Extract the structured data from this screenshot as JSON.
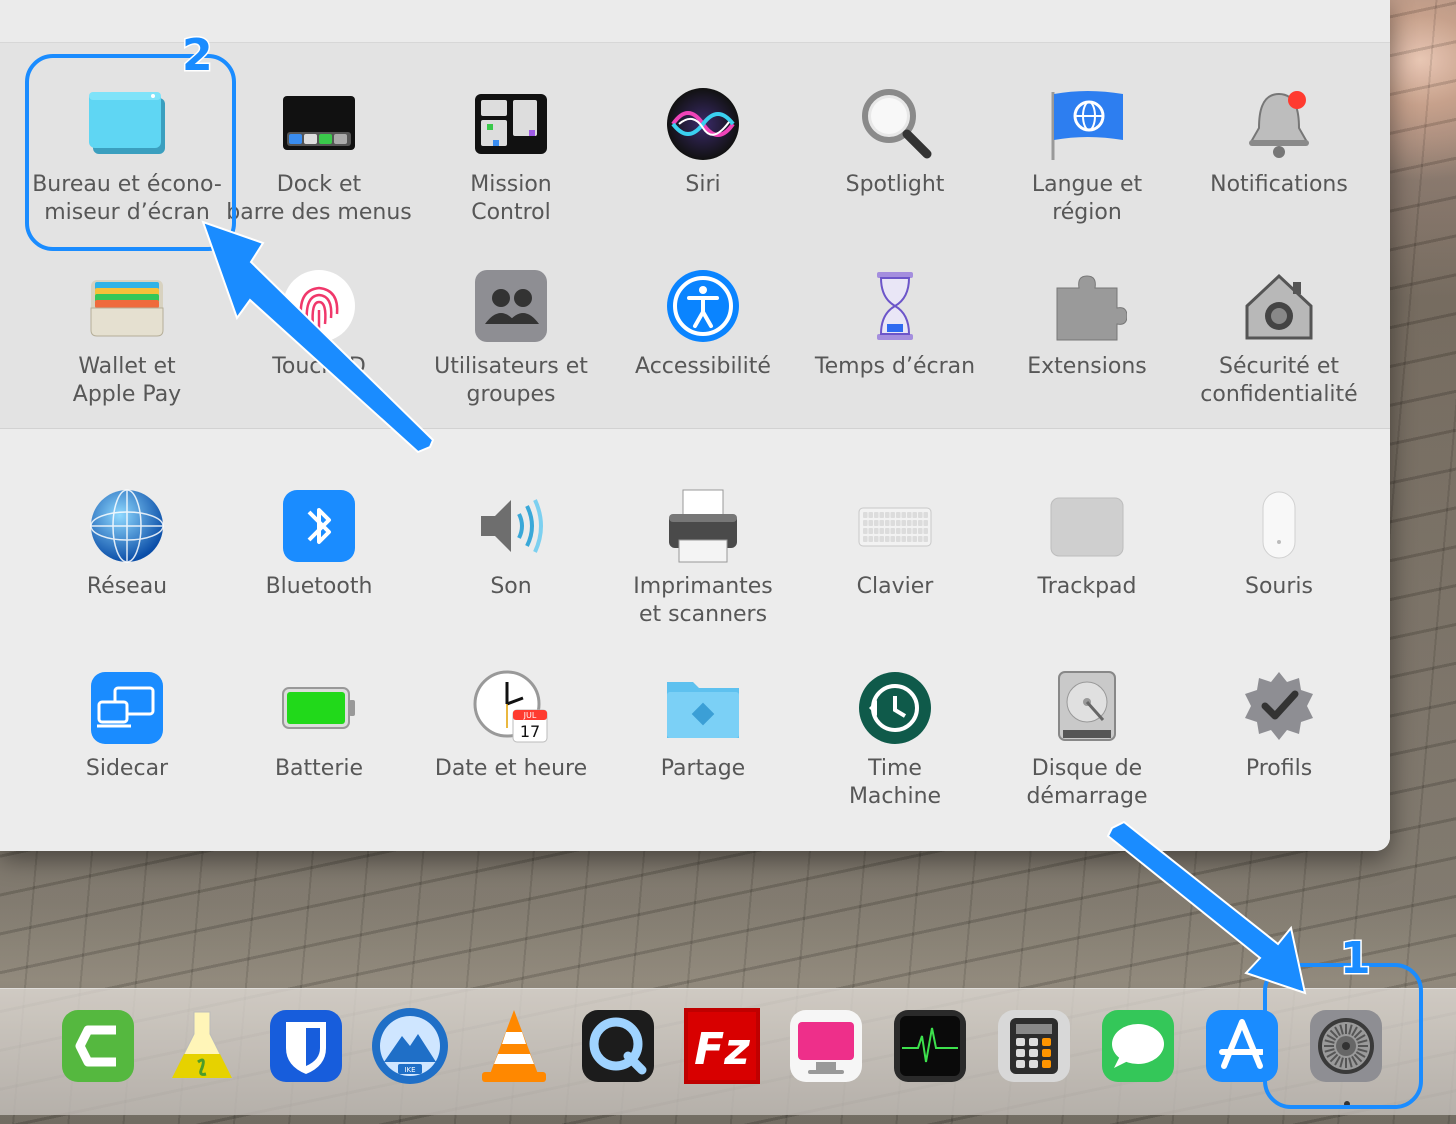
{
  "window": {
    "title": ""
  },
  "sections": [
    {
      "name": "personal",
      "panes": [
        {
          "id": "desktop-screensaver",
          "icon": "desktop-screensaver-icon",
          "lines": [
            "Bureau et écono-",
            "miseur d’écran"
          ]
        },
        {
          "id": "dock-menubar",
          "icon": "dock-icon",
          "lines": [
            "Dock et",
            "barre des menus"
          ]
        },
        {
          "id": "mission-control",
          "icon": "mission-control-icon",
          "lines": [
            "Mission",
            "Control"
          ]
        },
        {
          "id": "siri",
          "icon": "siri-icon",
          "lines": [
            "Siri"
          ]
        },
        {
          "id": "spotlight",
          "icon": "magnifier-icon",
          "lines": [
            "Spotlight"
          ]
        },
        {
          "id": "language-region",
          "icon": "flag-globe-icon",
          "lines": [
            "Langue et",
            "région"
          ]
        },
        {
          "id": "notifications",
          "icon": "bell-icon",
          "lines": [
            "Notifications"
          ]
        },
        {
          "id": "wallet",
          "icon": "wallet-icon",
          "lines": [
            "Wallet et",
            "Apple Pay"
          ]
        },
        {
          "id": "touch-id",
          "icon": "fingerprint-icon",
          "lines": [
            "Touch ID"
          ]
        },
        {
          "id": "users-groups",
          "icon": "users-icon",
          "lines": [
            "Utilisateurs et",
            "groupes"
          ]
        },
        {
          "id": "accessibility",
          "icon": "accessibility-icon",
          "lines": [
            "Accessibilité"
          ]
        },
        {
          "id": "screen-time",
          "icon": "hourglass-icon",
          "lines": [
            "Temps d’écran"
          ]
        },
        {
          "id": "extensions",
          "icon": "puzzle-icon",
          "lines": [
            "Extensions"
          ]
        },
        {
          "id": "security-privacy",
          "icon": "house-lock-icon",
          "lines": [
            "Sécurité et",
            "confidentialité"
          ]
        }
      ]
    },
    {
      "name": "hardware",
      "panes": [
        {
          "id": "network",
          "icon": "globe-network-icon",
          "lines": [
            "Réseau"
          ]
        },
        {
          "id": "bluetooth",
          "icon": "bluetooth-icon",
          "lines": [
            "Bluetooth"
          ]
        },
        {
          "id": "sound",
          "icon": "speaker-icon",
          "lines": [
            "Son"
          ]
        },
        {
          "id": "printers",
          "icon": "printer-icon",
          "lines": [
            "Imprimantes",
            "et scanners"
          ]
        },
        {
          "id": "keyboard",
          "icon": "keyboard-icon",
          "lines": [
            "Clavier"
          ]
        },
        {
          "id": "trackpad",
          "icon": "trackpad-icon",
          "lines": [
            "Trackpad"
          ]
        },
        {
          "id": "mouse",
          "icon": "mouse-icon",
          "lines": [
            "Souris"
          ]
        },
        {
          "id": "sidecar",
          "icon": "sidecar-icon",
          "lines": [
            "Sidecar"
          ]
        },
        {
          "id": "battery",
          "icon": "battery-icon",
          "lines": [
            "Batterie"
          ]
        },
        {
          "id": "date-time",
          "icon": "clock-calendar-icon",
          "lines": [
            "Date et heure"
          ],
          "calendar": {
            "month": "JUL",
            "day": "17"
          }
        },
        {
          "id": "sharing",
          "icon": "shared-folder-icon",
          "lines": [
            "Partage"
          ]
        },
        {
          "id": "time-machine",
          "icon": "time-machine-icon",
          "lines": [
            "Time",
            "Machine"
          ]
        },
        {
          "id": "startup-disk",
          "icon": "hard-disk-icon",
          "lines": [
            "Disque de",
            "démarrage"
          ]
        },
        {
          "id": "profiles",
          "icon": "checkmark-badge-icon",
          "lines": [
            "Profils"
          ]
        }
      ]
    }
  ],
  "dock": {
    "apps": [
      {
        "id": "partial-app",
        "icon": "partial-red-app-icon"
      },
      {
        "id": "camtasia",
        "icon": "camtasia-icon"
      },
      {
        "id": "lab-flask",
        "icon": "flask-app-icon"
      },
      {
        "id": "bitwarden",
        "icon": "bitwarden-shield-icon"
      },
      {
        "id": "ike",
        "icon": "ike-mountain-icon",
        "text": "IKE"
      },
      {
        "id": "vlc",
        "icon": "vlc-cone-icon"
      },
      {
        "id": "quicktime",
        "icon": "quicktime-icon"
      },
      {
        "id": "filezilla",
        "icon": "filezilla-icon",
        "text": "Fz"
      },
      {
        "id": "cleanmymac",
        "icon": "cleanmymac-icon"
      },
      {
        "id": "activity-monitor",
        "icon": "activity-monitor-icon"
      },
      {
        "id": "calculator",
        "icon": "calculator-icon"
      },
      {
        "id": "messages",
        "icon": "messages-bubble-icon"
      },
      {
        "id": "app-store",
        "icon": "app-store-icon"
      },
      {
        "id": "system-preferences",
        "icon": "system-preferences-gear-icon"
      }
    ]
  },
  "annotations": {
    "step1": "1",
    "step2": "2",
    "color": "#1a8cff"
  }
}
